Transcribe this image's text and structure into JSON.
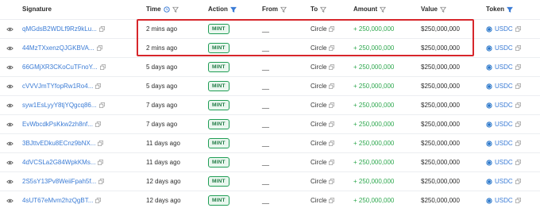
{
  "header": {
    "signature": "Signature",
    "time": "Time",
    "action": "Action",
    "from": "From",
    "to": "To",
    "amount": "Amount",
    "value": "Value",
    "token": "Token"
  },
  "rows": [
    {
      "signature": "qMGdsB2WDLf9Rz9kLu...",
      "time": "2 mins ago",
      "action": "MINT",
      "from": "__",
      "to": "Circle",
      "amount": "+ 250,000,000",
      "value": "$250,000,000",
      "token": "USDC"
    },
    {
      "signature": "44MzTXxenzQJGKBVA...",
      "time": "2 mins ago",
      "action": "MINT",
      "from": "__",
      "to": "Circle",
      "amount": "+ 250,000,000",
      "value": "$250,000,000",
      "token": "USDC"
    },
    {
      "signature": "66GMjXR3CKoCuTFnoY...",
      "time": "5 days ago",
      "action": "MINT",
      "from": "__",
      "to": "Circle",
      "amount": "+ 250,000,000",
      "value": "$250,000,000",
      "token": "USDC"
    },
    {
      "signature": "cVVVJmTYfopRw1Ro4...",
      "time": "5 days ago",
      "action": "MINT",
      "from": "__",
      "to": "Circle",
      "amount": "+ 250,000,000",
      "value": "$250,000,000",
      "token": "USDC"
    },
    {
      "signature": "syw1EsLyyY8tjYQgcq86...",
      "time": "7 days ago",
      "action": "MINT",
      "from": "__",
      "to": "Circle",
      "amount": "+ 250,000,000",
      "value": "$250,000,000",
      "token": "USDC"
    },
    {
      "signature": "EvWbcdkPsKkw2zh8nf...",
      "time": "7 days ago",
      "action": "MINT",
      "from": "__",
      "to": "Circle",
      "amount": "+ 250,000,000",
      "value": "$250,000,000",
      "token": "USDC"
    },
    {
      "signature": "3BJttvEDku8ECnz9bNX...",
      "time": "11 days ago",
      "action": "MINT",
      "from": "__",
      "to": "Circle",
      "amount": "+ 250,000,000",
      "value": "$250,000,000",
      "token": "USDC"
    },
    {
      "signature": "4dVCSLa2G84WpkKMs...",
      "time": "11 days ago",
      "action": "MINT",
      "from": "__",
      "to": "Circle",
      "amount": "+ 250,000,000",
      "value": "$250,000,000",
      "token": "USDC"
    },
    {
      "signature": "2S5sY13Pv8WeiiFpah5f...",
      "time": "12 days ago",
      "action": "MINT",
      "from": "__",
      "to": "Circle",
      "amount": "+ 250,000,000",
      "value": "$250,000,000",
      "token": "USDC"
    },
    {
      "signature": "4sUT67eMvm2hzQgBT...",
      "time": "12 days ago",
      "action": "MINT",
      "from": "__",
      "to": "Circle",
      "amount": "+ 250,000,000",
      "value": "$250,000,000",
      "token": "USDC"
    }
  ],
  "colors": {
    "link": "#3a7bd5",
    "amount_positive": "#2fa84f",
    "badge_border": "#1f9d55",
    "highlight": "#d7262b"
  },
  "icons": {
    "view": "eye-icon",
    "copy": "copy-icon",
    "time_help": "clock-icon",
    "filter": "funnel-icon",
    "token": "usdc-icon"
  }
}
